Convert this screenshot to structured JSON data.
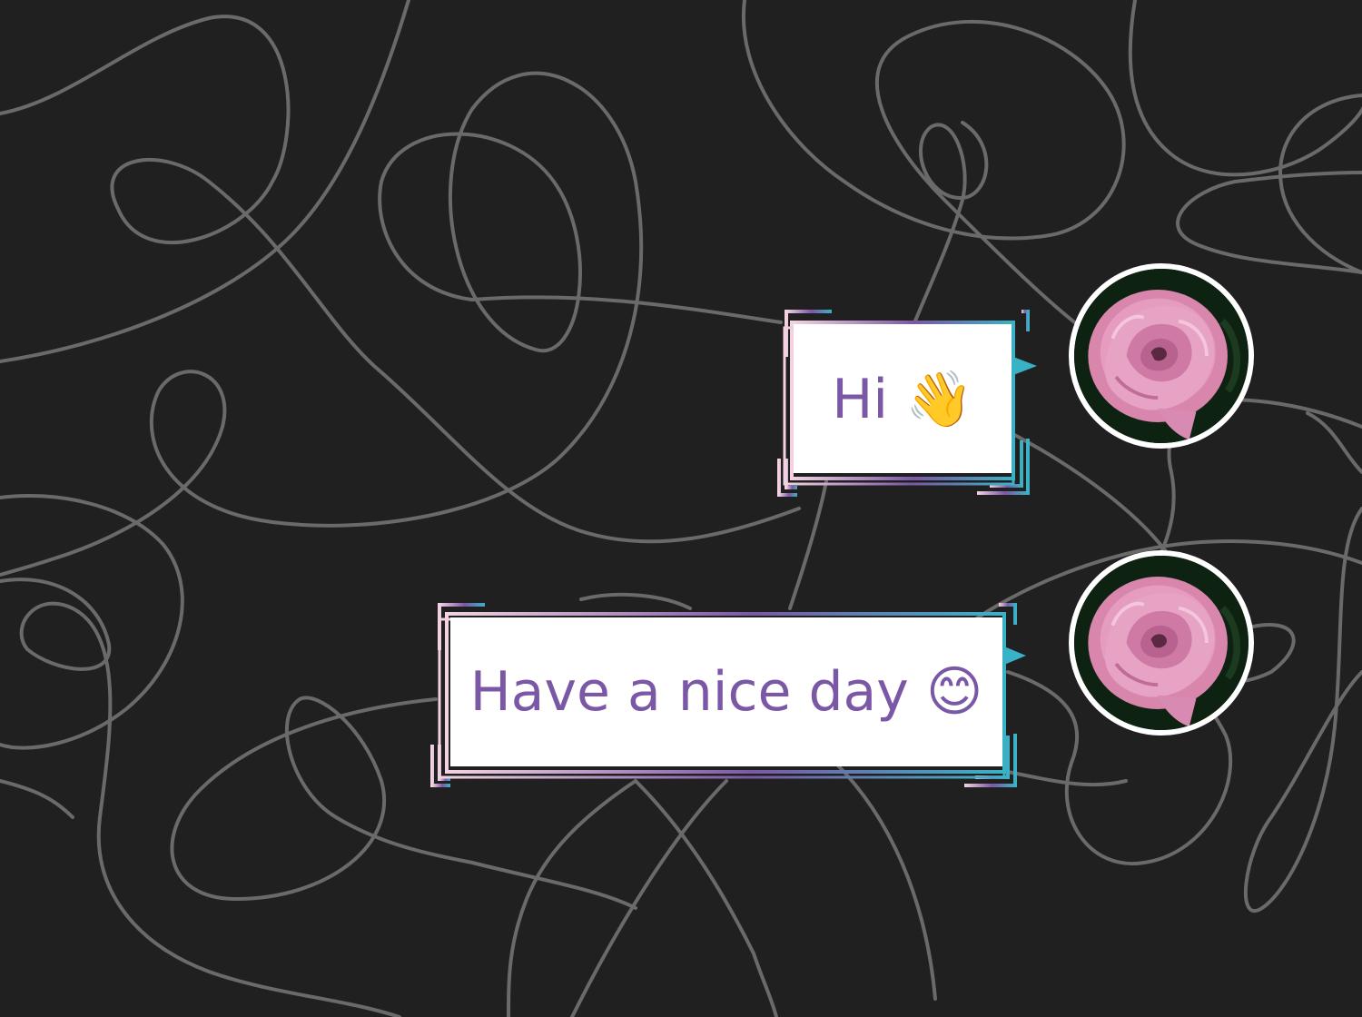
{
  "colors": {
    "background": "#202020",
    "squiggle": "#6a6a6a",
    "bubble_fill": "#ffffff",
    "text": "#7b58a6",
    "gradient": [
      "#f3d3e1",
      "#7b58a6",
      "#3ab2c6"
    ],
    "avatar_border": "#ffffff"
  },
  "messages": [
    {
      "text": "Hi 👋",
      "avatar_icon": "pink-rose-avatar"
    },
    {
      "text": "Have a nice day 😊",
      "avatar_icon": "pink-rose-avatar"
    }
  ]
}
